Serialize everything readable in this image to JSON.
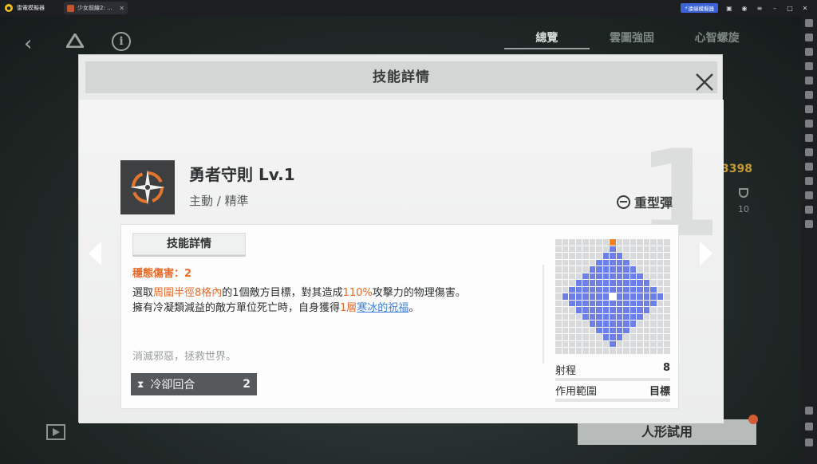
{
  "emulator": {
    "app_name": "雷電模擬器",
    "tab_title": "少女前線2: ...",
    "boost_label": "遠端模擬器"
  },
  "game": {
    "tabs": [
      {
        "label": "總覽",
        "active": true
      },
      {
        "label": "雲圖強固",
        "active": false
      },
      {
        "label": "心智螺旋",
        "active": false
      }
    ],
    "stat_value": "3398",
    "count_value": "10",
    "try_button": "人形試用"
  },
  "modal": {
    "title": "技能詳情",
    "skill": {
      "name": "勇者守則 Lv.1",
      "type": "主動 / 精準",
      "ammo": "重型彈",
      "big_number": "1"
    },
    "detail_tab": "技能詳情",
    "stability_damage": "穩態傷害：2",
    "description": {
      "p1": "選取",
      "p2": "周圍半徑8格內",
      "p3": "的1個敵方目標，對其造成",
      "p4": "110%",
      "p5": "攻擊力的物理傷害。",
      "p6": "擁有冷凝類減益的敵方單位死亡時，自身獲得",
      "p7": "1層",
      "p8": "寒冰的祝福",
      "p9": "。"
    },
    "flavor": "消滅邪惡，拯救世界。",
    "cooldown": {
      "label": "冷卻回合",
      "value": "2"
    },
    "range": {
      "label": "射程",
      "value": "8"
    },
    "area": {
      "label": "作用範圍",
      "value": "目標"
    }
  },
  "colors": {
    "highlight": "#e86a2a",
    "link": "#3d7dd8",
    "range_cell": "#6b7fe6",
    "target_cell": "#f0842c"
  }
}
